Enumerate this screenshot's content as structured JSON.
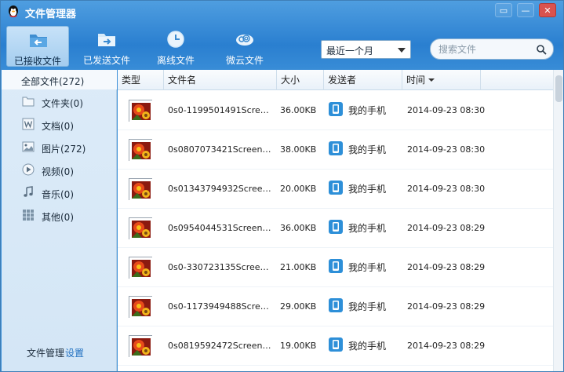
{
  "window": {
    "title": "文件管理器",
    "controls": {
      "skin": "▭",
      "minimize": "—",
      "close": "✕"
    }
  },
  "toolbar": {
    "tabs": [
      {
        "label": "已接收文件",
        "icon": "folder-receive-icon",
        "active": true
      },
      {
        "label": "已发送文件",
        "icon": "folder-send-icon",
        "active": false
      },
      {
        "label": "离线文件",
        "icon": "clock-icon",
        "active": false
      },
      {
        "label": "微云文件",
        "icon": "cloud-icon",
        "active": false
      }
    ],
    "filter": {
      "selected": "最近一个月"
    },
    "search": {
      "placeholder": "搜索文件"
    }
  },
  "sidebar": {
    "header": "全部文件(272)",
    "items": [
      {
        "label": "文件夹(0)",
        "icon": "folder-icon"
      },
      {
        "label": "文档(0)",
        "icon": "word-doc-icon"
      },
      {
        "label": "图片(272)",
        "icon": "image-icon"
      },
      {
        "label": "视频(0)",
        "icon": "play-icon"
      },
      {
        "label": "音乐(0)",
        "icon": "music-note-icon"
      },
      {
        "label": "其他(0)",
        "icon": "grid-icon"
      }
    ],
    "footer": {
      "text": "文件管理",
      "link": "设置"
    }
  },
  "table": {
    "columns": [
      "类型",
      "文件名",
      "大小",
      "发送者",
      "时间"
    ],
    "rows": [
      {
        "name": "0s0-1199501491Screens...",
        "size": "36.00KB",
        "sender": "我的手机",
        "time": "2014-09-23 08:30"
      },
      {
        "name": "0s0807073421Screensho...",
        "size": "38.00KB",
        "sender": "我的手机",
        "time": "2014-09-23 08:30"
      },
      {
        "name": "0s01343794932Screensh...",
        "size": "20.00KB",
        "sender": "我的手机",
        "time": "2014-09-23 08:30"
      },
      {
        "name": "0s0954044531Screensho...",
        "size": "36.00KB",
        "sender": "我的手机",
        "time": "2014-09-23 08:29"
      },
      {
        "name": "0s0-330723135Screensh...",
        "size": "21.00KB",
        "sender": "我的手机",
        "time": "2014-09-23 08:29"
      },
      {
        "name": "0s0-1173949488Screens...",
        "size": "29.00KB",
        "sender": "我的手机",
        "time": "2014-09-23 08:29"
      },
      {
        "name": "0s0819592472Screensho...",
        "size": "19.00KB",
        "sender": "我的手机",
        "time": "2014-09-23 08:29"
      }
    ]
  },
  "colors": {
    "accent": "#2a7fd0",
    "link": "#1f6fc0",
    "active_tab": "#b6d8f4"
  }
}
